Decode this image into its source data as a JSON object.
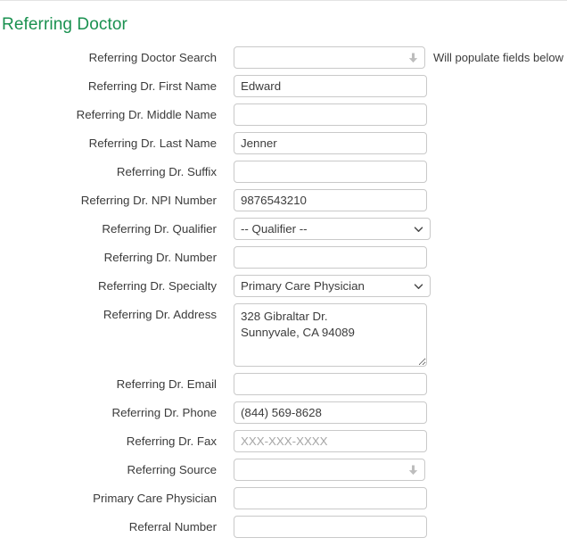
{
  "section": {
    "title": "Referring Doctor",
    "title_color": "#1a9150"
  },
  "helper": {
    "search_hint": "Will populate fields below"
  },
  "icons": {
    "autocomplete_arrow": "arrow-down-icon",
    "select_chevron": "chevron-down-icon",
    "textarea_grip": "resize-grip-icon"
  },
  "fields": [
    {
      "label": "Referring Doctor Search",
      "type": "autocomplete",
      "value": "",
      "name": "referring-doctor-search"
    },
    {
      "label": "Referring Dr. First Name",
      "type": "text",
      "value": "Edward",
      "placeholder": "",
      "name": "referring-dr-first-name"
    },
    {
      "label": "Referring Dr. Middle Name",
      "type": "text",
      "value": "",
      "placeholder": "",
      "name": "referring-dr-middle-name"
    },
    {
      "label": "Referring Dr. Last Name",
      "type": "text",
      "value": "Jenner",
      "placeholder": "",
      "name": "referring-dr-last-name"
    },
    {
      "label": "Referring Dr. Suffix",
      "type": "text",
      "value": "",
      "placeholder": "",
      "name": "referring-dr-suffix"
    },
    {
      "label": "Referring Dr. NPI Number",
      "type": "text",
      "value": "9876543210",
      "placeholder": "",
      "name": "referring-dr-npi-number"
    },
    {
      "label": "Referring Dr. Qualifier",
      "type": "select",
      "value": "-- Qualifier --",
      "name": "referring-dr-qualifier"
    },
    {
      "label": "Referring Dr. Number",
      "type": "text",
      "value": "",
      "placeholder": "",
      "name": "referring-dr-number"
    },
    {
      "label": "Referring Dr. Specialty",
      "type": "select",
      "value": "Primary Care Physician",
      "name": "referring-dr-specialty"
    },
    {
      "label": "Referring Dr. Address",
      "type": "textarea",
      "value": "328 Gibraltar Dr.\nSunnyvale, CA 94089",
      "placeholder": "",
      "name": "referring-dr-address"
    },
    {
      "label": "Referring Dr. Email",
      "type": "text",
      "value": "",
      "placeholder": "",
      "name": "referring-dr-email"
    },
    {
      "label": "Referring Dr. Phone",
      "type": "text",
      "value": "(844) 569-8628",
      "placeholder": "",
      "name": "referring-dr-phone"
    },
    {
      "label": "Referring Dr. Fax",
      "type": "text",
      "value": "",
      "placeholder": "XXX-XXX-XXXX",
      "name": "referring-dr-fax"
    },
    {
      "label": "Referring Source",
      "type": "autocomplete",
      "value": "",
      "name": "referring-source"
    },
    {
      "label": "Primary Care Physician",
      "type": "text",
      "value": "",
      "placeholder": "",
      "name": "primary-care-physician"
    },
    {
      "label": "Referral Number",
      "type": "text",
      "value": "",
      "placeholder": "",
      "name": "referral-number"
    }
  ]
}
